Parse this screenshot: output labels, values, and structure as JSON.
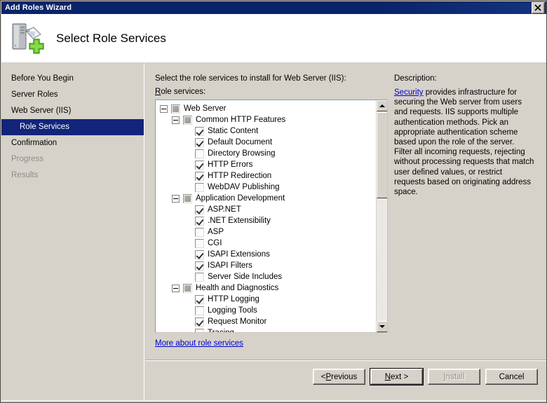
{
  "window": {
    "title": "Add Roles Wizard",
    "close_label": "Close"
  },
  "header": {
    "title": "Select Role Services",
    "icon": "server-add-icon"
  },
  "sidebar": {
    "items": [
      {
        "label": "Before You Begin",
        "state": "normal",
        "level": 0
      },
      {
        "label": "Server Roles",
        "state": "normal",
        "level": 0
      },
      {
        "label": "Web Server (IIS)",
        "state": "normal",
        "level": 0
      },
      {
        "label": "Role Services",
        "state": "selected",
        "level": 1
      },
      {
        "label": "Confirmation",
        "state": "normal",
        "level": 0
      },
      {
        "label": "Progress",
        "state": "disabled",
        "level": 0
      },
      {
        "label": "Results",
        "state": "disabled",
        "level": 0
      }
    ]
  },
  "main": {
    "prompt": "Select the role services to install for Web Server (IIS):",
    "list_label_prefix": "R",
    "list_label_rest": "ole services:",
    "more_link": "More about role services",
    "tree": [
      {
        "label": "Web Server",
        "level": 0,
        "check": "partial",
        "expander": "minus"
      },
      {
        "label": "Common HTTP Features",
        "level": 1,
        "check": "partial",
        "expander": "minus"
      },
      {
        "label": "Static Content",
        "level": 2,
        "check": "checked",
        "expander": "none"
      },
      {
        "label": "Default Document",
        "level": 2,
        "check": "checked",
        "expander": "none"
      },
      {
        "label": "Directory Browsing",
        "level": 2,
        "check": "unchecked",
        "expander": "none"
      },
      {
        "label": "HTTP Errors",
        "level": 2,
        "check": "checked",
        "expander": "none"
      },
      {
        "label": "HTTP Redirection",
        "level": 2,
        "check": "checked",
        "expander": "none"
      },
      {
        "label": "WebDAV Publishing",
        "level": 2,
        "check": "unchecked",
        "expander": "none"
      },
      {
        "label": "Application Development",
        "level": 1,
        "check": "partial",
        "expander": "minus"
      },
      {
        "label": "ASP.NET",
        "level": 2,
        "check": "checked",
        "expander": "none"
      },
      {
        "label": ".NET Extensibility",
        "level": 2,
        "check": "checked",
        "expander": "none"
      },
      {
        "label": "ASP",
        "level": 2,
        "check": "unchecked",
        "expander": "none"
      },
      {
        "label": "CGI",
        "level": 2,
        "check": "unchecked",
        "expander": "none"
      },
      {
        "label": "ISAPI Extensions",
        "level": 2,
        "check": "checked",
        "expander": "none"
      },
      {
        "label": "ISAPI Filters",
        "level": 2,
        "check": "checked",
        "expander": "none"
      },
      {
        "label": "Server Side Includes",
        "level": 2,
        "check": "unchecked",
        "expander": "none"
      },
      {
        "label": "Health and Diagnostics",
        "level": 1,
        "check": "partial",
        "expander": "minus"
      },
      {
        "label": "HTTP Logging",
        "level": 2,
        "check": "checked",
        "expander": "none"
      },
      {
        "label": "Logging Tools",
        "level": 2,
        "check": "unchecked",
        "expander": "none"
      },
      {
        "label": "Request Monitor",
        "level": 2,
        "check": "checked",
        "expander": "none"
      },
      {
        "label": "Tracing",
        "level": 2,
        "check": "unchecked",
        "expander": "none"
      }
    ]
  },
  "description": {
    "heading": "Description:",
    "link_text": "Security",
    "body": " provides infrastructure for securing the Web server from users and requests. IIS supports multiple authentication methods. Pick an appropriate authentication scheme based upon the role of the server. Filter all incoming requests, rejecting without processing requests that match user defined values, or restrict requests based on originating address space."
  },
  "buttons": [
    {
      "name": "previous",
      "pre": "< ",
      "accel": "P",
      "post": "revious",
      "state": "normal"
    },
    {
      "name": "next",
      "pre": "",
      "accel": "N",
      "post": "ext >",
      "state": "default"
    },
    {
      "name": "install",
      "pre": "",
      "accel": "I",
      "post": "nstall",
      "state": "disabled"
    },
    {
      "name": "cancel",
      "pre": "Cancel",
      "accel": "",
      "post": "",
      "state": "normal"
    }
  ],
  "colors": {
    "titlebar": "#0a246a",
    "selection": "#12257b",
    "face": "#d6d2ca",
    "link": "#0000d0"
  }
}
